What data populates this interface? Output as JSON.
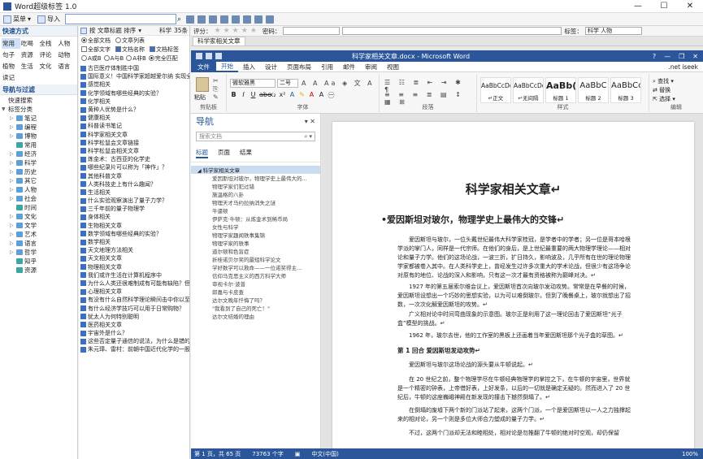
{
  "window": {
    "title": "Word超级标签 1.0",
    "controls": [
      "—",
      "☐",
      "✕"
    ]
  },
  "toolbar": {
    "menu_label": "菜单",
    "import_label": "导入",
    "search_value": ""
  },
  "left": {
    "quick_title": "快速方式",
    "quick_items": [
      "常用",
      "吃喝",
      "全栈",
      "人物",
      "句子",
      "资源",
      "评论",
      "动物",
      "植物",
      "生活",
      "文化",
      "语言",
      "读记"
    ],
    "nav_title": "导航与过滤",
    "tree": [
      {
        "label": "快速搜索",
        "level": 0,
        "exp": "",
        "color": "none"
      },
      {
        "label": "标签分类",
        "level": 0,
        "exp": "▼",
        "color": "none"
      },
      {
        "label": "笔记",
        "level": 1,
        "exp": "▷",
        "color": "blue"
      },
      {
        "label": "编程",
        "level": 1,
        "exp": "▷",
        "color": "blue"
      },
      {
        "label": "博物",
        "level": 1,
        "exp": "▷",
        "color": "blue"
      },
      {
        "label": "常用",
        "level": 1,
        "exp": "",
        "color": "teal"
      },
      {
        "label": "经济",
        "level": 1,
        "exp": "▷",
        "color": "blue"
      },
      {
        "label": "科学",
        "level": 1,
        "exp": "▷",
        "color": "blue"
      },
      {
        "label": "历史",
        "level": 1,
        "exp": "▷",
        "color": "blue"
      },
      {
        "label": "其它",
        "level": 1,
        "exp": "▷",
        "color": "blue"
      },
      {
        "label": "人物",
        "level": 1,
        "exp": "▷",
        "color": "blue"
      },
      {
        "label": "社会",
        "level": 1,
        "exp": "▷",
        "color": "blue"
      },
      {
        "label": "时间",
        "level": 1,
        "exp": "",
        "color": "teal"
      },
      {
        "label": "文化",
        "level": 1,
        "exp": "▷",
        "color": "blue"
      },
      {
        "label": "文学",
        "level": 1,
        "exp": "▷",
        "color": "blue"
      },
      {
        "label": "艺术",
        "level": 1,
        "exp": "▷",
        "color": "blue"
      },
      {
        "label": "语言",
        "level": 1,
        "exp": "▷",
        "color": "blue"
      },
      {
        "label": "哲学",
        "level": 1,
        "exp": "▷",
        "color": "blue"
      },
      {
        "label": "知乎",
        "level": 1,
        "exp": "",
        "color": "teal"
      },
      {
        "label": "资源",
        "level": 1,
        "exp": "",
        "color": "teal"
      }
    ]
  },
  "middle": {
    "sort_label": "按 文章标题 排序",
    "sort_filter": "科学",
    "sort_count": "35条",
    "options_row1": [
      "全部文档",
      "文章列表"
    ],
    "options_row2": [
      "全部文字",
      "文档名称",
      "文档标签"
    ],
    "options_row3": [
      "A或B",
      "A与B",
      "A非B",
      "完全匹配"
    ],
    "docs": [
      "古巴医疗体制胜中国",
      "国际意义！中国科学家超越爱尔纳 实现全数",
      "感觉相关",
      "化学领域有哪些经典的实验？",
      "化学相关",
      "黄种人优势是什么？",
      "健康相关",
      "科普读书笔记",
      "科学家相关文章",
      "科学松鼠会文章链接",
      "科学松鼠会相关文章",
      "炼金术：古西亚的化学史",
      "哪些纪录片可以称为「神作」？",
      "其他科普文章",
      "人类科技史上有什么趣闻？",
      "生活相关",
      "什么实验观察演出了量子力学？",
      "三千年前的量子物理学",
      "身体相关",
      "生物相关文章",
      "数学领域有哪些经典的实验？",
      "数学相关",
      "天文地理方法相关",
      "天文相关文章",
      "物理相关文章",
      "我们或许生活在计算机程序中",
      "为什么人类还很难制成有可能有缺陷？但",
      "心理相关文章",
      "有没有什么自然科学理论瞬间击中你以至于",
      "有什么经济学技巧可以用于日常购物？",
      "犹太人为何特别聪明",
      "医药相关文章",
      "宇宙外是什么？",
      "这些否定量子通信的说法，为什么是错的？",
      "朱元璋、雷村：前朝中国近代化学的一股新"
    ]
  },
  "right": {
    "rating_label": "评分：",
    "password_label": "密码：",
    "tag_label": "标签：",
    "tag_value": "科学 人物",
    "file_tab": "科学家相关文章"
  },
  "word": {
    "title": "科学家相关文章.docx - Microsoft Word",
    "tabs": [
      "文件",
      "开始",
      "插入",
      "设计",
      "页面布局",
      "引用",
      "邮件",
      "审阅",
      "视图"
    ],
    "active_tab": "开始",
    "user": ".net iseek",
    "font_name": "微软雅黑",
    "font_size": "二号",
    "groups": {
      "clipboard": "剪贴板",
      "font": "字体",
      "paragraph": "段落",
      "styles": "样式",
      "editing": "编辑"
    },
    "styles": [
      {
        "sample": "AaBbCcDd",
        "name": "↵正文",
        "kind": "normal"
      },
      {
        "sample": "AaBbCcDd",
        "name": "↵无间隔",
        "kind": "normal"
      },
      {
        "sample": "AaBb(",
        "name": "标题 1",
        "kind": "big"
      },
      {
        "sample": "AaBbC",
        "name": "标题 2",
        "kind": "mid"
      },
      {
        "sample": "AaBbCc",
        "name": "标题 3",
        "kind": "mid"
      }
    ],
    "editing_items": [
      "查找 ▾",
      "替换",
      "选择 ▾"
    ],
    "clipboard_paste": "粘贴",
    "nav": {
      "title": "导航",
      "search_placeholder": "搜索文档",
      "tabs": [
        "标题",
        "页面",
        "结果"
      ],
      "items": [
        {
          "text": "科学家相关文章",
          "level": 1
        },
        {
          "text": "爱因斯坦对玻尔，物理学史上最伟大的...",
          "level": 2
        },
        {
          "text": "物理学家们犯过错",
          "level": 2
        },
        {
          "text": "施温格的八卦",
          "level": 2
        },
        {
          "text": "物理天才马约拉纳消失之谜",
          "level": 2
        },
        {
          "text": "牛逼顿",
          "level": 2
        },
        {
          "text": "伊萨克·牛顿：从炼金术到稀币局",
          "level": 2
        },
        {
          "text": "女性与科学",
          "level": 2
        },
        {
          "text": "物理学家趣闻轶事集锦",
          "level": 2
        },
        {
          "text": "物理学家的轶事",
          "level": 2
        },
        {
          "text": "道尔顿和色盲症",
          "level": 2
        },
        {
          "text": "折桂诺贝尔奖的最短科学论文",
          "level": 2
        },
        {
          "text": "学好数学可以救命——一位诺奖得主...",
          "level": 2
        },
        {
          "text": "信仰马克思主义的西方科学大师",
          "level": 2
        },
        {
          "text": "审视卡尔·波普",
          "level": 2
        },
        {
          "text": "郎嘉与卡皮查",
          "level": 2
        },
        {
          "text": "达尔文晚年忏悔了吗？",
          "level": 2
        },
        {
          "text": "\"我看到了自己的死亡！\"",
          "level": 2
        },
        {
          "text": "达尔文结婚的理由",
          "level": 2
        }
      ]
    },
    "document": {
      "h1": "科学家相关文章↵",
      "h2": "•爱因斯坦对玻尔，物理学史上最伟大的交锋↵",
      "p1": "爱因斯坦与玻尔，一位头戴世纪最伟大科学家桂冠，是学者中的学者；另一位是哥本哈根学派的掌门人，同样是一代宗师。在他们的身后，是上世纪最重要的两大物理学理论——相对论和量子力学。他们的这场论战，一波三折，扩日持久，影响波及，几乎所有在世的理论物理学家都被卷入其中。在人类科学史上，曾经发生过许多次重大的学术论战，但很少有这场争论对原有的地位、论战的深入和影响，只有这一次才最有资格被称为巅峰对决。↵",
      "p2": "1927 年的第五届索尔维会议上，爱因斯坦首次向玻尔发动攻势。常常是在早餐的时候，爱因斯坦设想出一个巧妙的思想实验，以为可以难倒玻尔，但到了晚餐桌上，玻尔就想出了招数，一次次化解爱因斯坦的攻势。↵",
      "p3": "广义相对论中时间弯曲现象的示意图。玻尔正是利用了这一理论回击了爱因斯坦“光子盒”模型的挑战。↵",
      "p4": "1962 年，玻尔去世，他的工作室的黑板上还画着当年爱因斯坦那个光子盒的草图。↵",
      "h3": "第 1 回合  爱因斯坦发动攻势↵",
      "p5": "爱因斯坦与玻尔这场论战的源头要从牛顿说起。↵",
      "p6": "在 20 世纪之前，整个物理学尽在牛顿经典物理学的掌控之下，在牛顿的宇宙里，世界就是一个精密的钟表，上帝借好表，上好发条，以后的一切就是确定无疑的。然而进入了 20 世纪后，牛顿的这座巍峨神殿在新发现的撞击下撼然倒塌了。↵",
      "p7": "在倒塌的废墟下两个新的门派站了起来，这两个门派，一个是爱因斯坦以一人之力独撑起来的相对论，另一个则是多位大师合力塑成的量子力学。↵",
      "p8": "不过，这两个门派却无法和睦相处，相对论是勿推翻了牛顿的绝对时空观，却仍保留"
    },
    "status": {
      "page": "第 1 页，共 65 页",
      "words": "73763 个字",
      "lang": "中文(中国)",
      "zoom": "100%"
    }
  }
}
